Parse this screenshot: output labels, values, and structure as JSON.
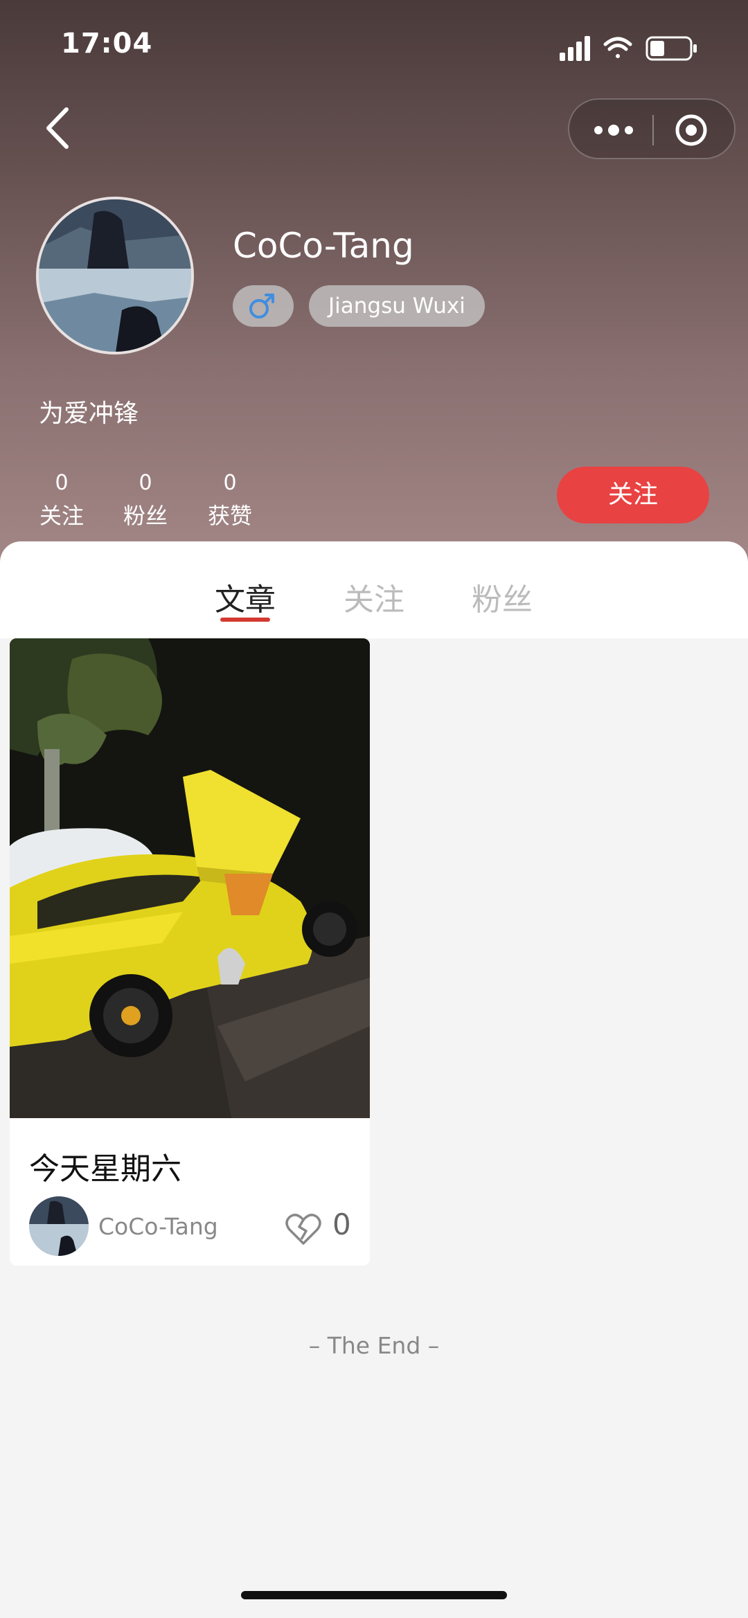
{
  "status": {
    "time": "17:04",
    "signal_icon": "cellular-signal-icon",
    "wifi_icon": "wifi-icon",
    "battery_icon": "battery-icon"
  },
  "nav": {
    "back_icon": "chevron-left-icon",
    "more_icon": "more-dots-icon",
    "close_icon": "target-circle-icon"
  },
  "profile": {
    "username": "CoCo-Tang",
    "gender_symbol": "♂",
    "location": "Jiangsu Wuxi",
    "bio": "为爱冲锋",
    "stats": [
      {
        "value": "0",
        "label": "关注"
      },
      {
        "value": "0",
        "label": "粉丝"
      },
      {
        "value": "0",
        "label": "获赞"
      }
    ],
    "follow_label": "关注"
  },
  "tabs": [
    {
      "label": "文章",
      "active": true
    },
    {
      "label": "关注",
      "active": false
    },
    {
      "label": "粉丝",
      "active": false
    }
  ],
  "posts": [
    {
      "title": "今天星期六",
      "author": "CoCo-Tang",
      "likes": "0"
    }
  ],
  "footer": {
    "end_text": "– The End –"
  },
  "colors": {
    "accent": "#e94242",
    "tab_underline": "#d43a30"
  }
}
